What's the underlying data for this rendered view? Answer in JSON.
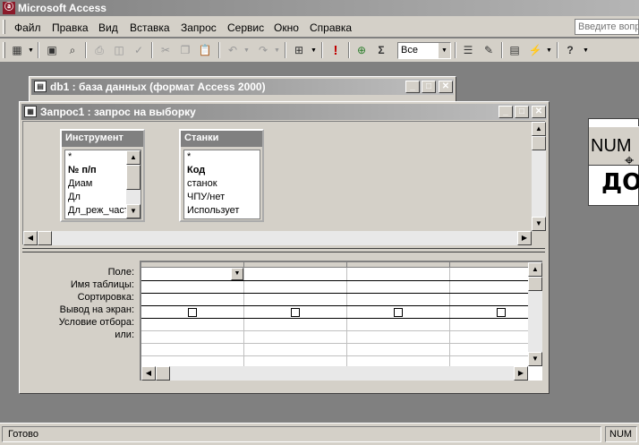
{
  "app": {
    "title": "Microsoft Access"
  },
  "menu": {
    "items": [
      "Файл",
      "Правка",
      "Вид",
      "Вставка",
      "Запрос",
      "Сервис",
      "Окно",
      "Справка"
    ],
    "help_placeholder": "Введите вопр"
  },
  "toolbar": {
    "top_values": "Все"
  },
  "db_window": {
    "title": "db1 : база данных (формат Access 2000)"
  },
  "query_window": {
    "title": "Запрос1 : запрос на выборку"
  },
  "tables": [
    {
      "name": "Инструмент",
      "fields": [
        "*",
        "№ п/п",
        "Диам",
        "Дл",
        "Дл_реж_част"
      ]
    },
    {
      "name": "Станки",
      "fields": [
        "*",
        "Код",
        "станок",
        "ЧПУ/нет",
        "Использует"
      ]
    }
  ],
  "grid": {
    "row_labels": [
      "Поле:",
      "Имя таблицы:",
      "Сортировка:",
      "Вывод на экран:",
      "Условие отбора:",
      "или:"
    ]
  },
  "behind_window": {
    "num_text": "NUM",
    "do_text": "ДО"
  },
  "status": {
    "left": "Готово",
    "right": "NUM"
  }
}
